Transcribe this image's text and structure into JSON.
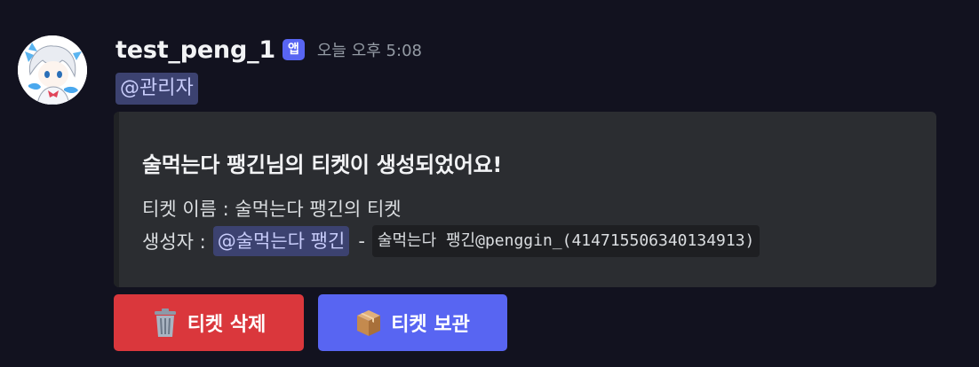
{
  "message": {
    "username": "test_peng_1",
    "app_badge": "앱",
    "timestamp": "오늘 오후 5:08",
    "mention": "@관리자"
  },
  "embed": {
    "title": "술먹는다 팽긴님의 티켓이 생성되었어요!",
    "line1": "티켓 이름 : 술먹는다 팽긴의 티켓",
    "creator_label": "생성자 :",
    "creator_mention": "@술먹는다 팽긴",
    "separator": "-",
    "creator_code": "술먹는다 팽긴@penggin_(414715506340134913)"
  },
  "buttons": {
    "delete": {
      "label": "티켓 삭제",
      "icon": "wastebasket-icon"
    },
    "archive": {
      "label": "티켓 보관",
      "icon": "package-icon"
    }
  },
  "colors": {
    "background": "#12121f",
    "embed_bg": "#2b2d31",
    "mention_bg": "#3c4270",
    "danger": "#da373c",
    "primary": "#5865f2",
    "badge": "#5865f2"
  }
}
